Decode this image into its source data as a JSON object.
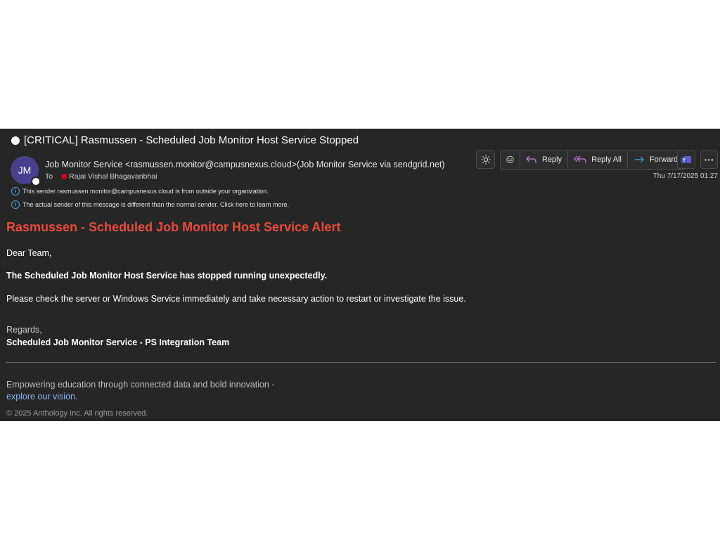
{
  "email": {
    "subject": "[CRITICAL] Rasmussen - Scheduled Job Monitor Host Service Stopped",
    "avatar_initials": "JM",
    "sender": "Job Monitor Service <rasmussen.monitor@campusnexus.cloud>(Job Monitor Service via sendgrid.net)",
    "to_label": "To",
    "recipient": "Rajai Vishal Bhagavanbhai",
    "timestamp": "Thu 7/17/2025 01:27",
    "info_external": "This sender rasmussen.monitor@campusnexus.cloud is from outside your organization.",
    "info_different_sender": "The actual sender of this message is different than the normal sender. Click here to learn more."
  },
  "toolbar": {
    "theme_icon": "sun-icon",
    "emoji_icon": "smiley-icon",
    "reply_label": "Reply",
    "reply_all_label": "Reply All",
    "forward_label": "Forward",
    "teams_icon": "teams-icon",
    "more_icon": "more-icon",
    "more_glyph": "···"
  },
  "body": {
    "alert_title": "Rasmussen - Scheduled Job Monitor Host Service Alert",
    "greeting": "Dear Team,",
    "statement": "The Scheduled Job Monitor Host Service has stopped running unexpectedly.",
    "instruction": "Please check the server or Windows Service immediately and take necessary action to restart or investigate the issue.",
    "regards": "Regards,",
    "signature": "Scheduled Job Monitor Service - PS Integration Team"
  },
  "footer": {
    "tagline": "Empowering education through connected data and bold innovation -",
    "link_text": "explore our vision",
    "link_suffix": ".",
    "copyright": "© 2025 Anthology Inc. All rights reserved."
  },
  "colors": {
    "panel_bg": "#262626",
    "alert_red": "#e84a3d",
    "avatar_purple": "#4a3f8f",
    "link_blue": "#8ab4f8",
    "info_blue": "#4aa3df",
    "presence_red": "#d0021b"
  }
}
